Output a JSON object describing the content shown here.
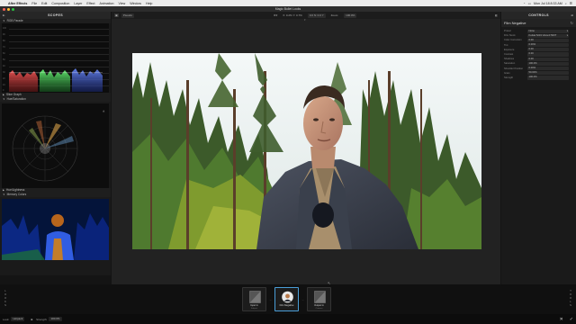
{
  "menubar": {
    "app": "After Effects",
    "items": [
      "File",
      "Edit",
      "Composition",
      "Layer",
      "Effect",
      "Animation",
      "View",
      "Window",
      "Help"
    ],
    "clock": "Mon Jul 18 8:33 AM"
  },
  "window": {
    "title": "Magic Bullet Looks"
  },
  "scopes": {
    "title": "SCOPES",
    "rgb_label": "RGB Parade",
    "parade_ticks": [
      "100",
      "90",
      "80",
      "70",
      "60",
      "50",
      "40",
      "30",
      "20",
      "10",
      "0"
    ],
    "slice_graph": "Slice Graph",
    "hue_saturation": "Hue/Saturation",
    "hue_lightness": "Hue/Lightness",
    "memory_colors": "Memory Colors"
  },
  "viewer": {
    "mode": "Pseudo",
    "res_value": "X: 0.2% Y: 0.7%",
    "coord_value": "0.0 N: 0.0 Y",
    "zoom_label": "Zoom:",
    "zoom_value": "100.0%"
  },
  "controls": {
    "title": "CONTROLS",
    "tool_name": "Film Negative",
    "params": [
      {
        "name": "Preset",
        "value": "None",
        "dropdown": true
      },
      {
        "name": "Film Stock",
        "value": "Kodak 5219 Vision3 500T",
        "dropdown": true
      },
      {
        "name": "Color Correction",
        "value": "0.00"
      },
      {
        "name": "Tint",
        "value": "0.00%"
      },
      {
        "name": "Exposure",
        "value": "0.00"
      },
      {
        "name": "Contrast",
        "value": "0.00"
      },
      {
        "name": "Shadows",
        "value": "0.00"
      },
      {
        "name": "Saturation",
        "value": "100.0%"
      },
      {
        "name": "Shoulder Position",
        "value": "0.00%"
      },
      {
        "name": "Grain",
        "value": "50.00%"
      },
      {
        "name": "Strength",
        "value": "100.0%"
      }
    ]
  },
  "strip": {
    "left_label": "LOOKS",
    "right_label": "TOOLS",
    "tools": [
      {
        "name": "Input In",
        "sub": "Subject"
      },
      {
        "name": "Film Negative",
        "sub": ""
      },
      {
        "name": "Output In",
        "sub": "Camera"
      }
    ]
  },
  "status": {
    "look_label": "Look:",
    "look_value": "Hotpack",
    "strength_label": "Strength:",
    "strength_value": "100.0%",
    "cancel": "✕",
    "ok": "✓"
  },
  "colors": {
    "accent": "#4a9ed8",
    "panel": "#1a1a1a",
    "red": "#d23a3a",
    "green": "#2fa64a",
    "blue": "#3a5fd8"
  }
}
